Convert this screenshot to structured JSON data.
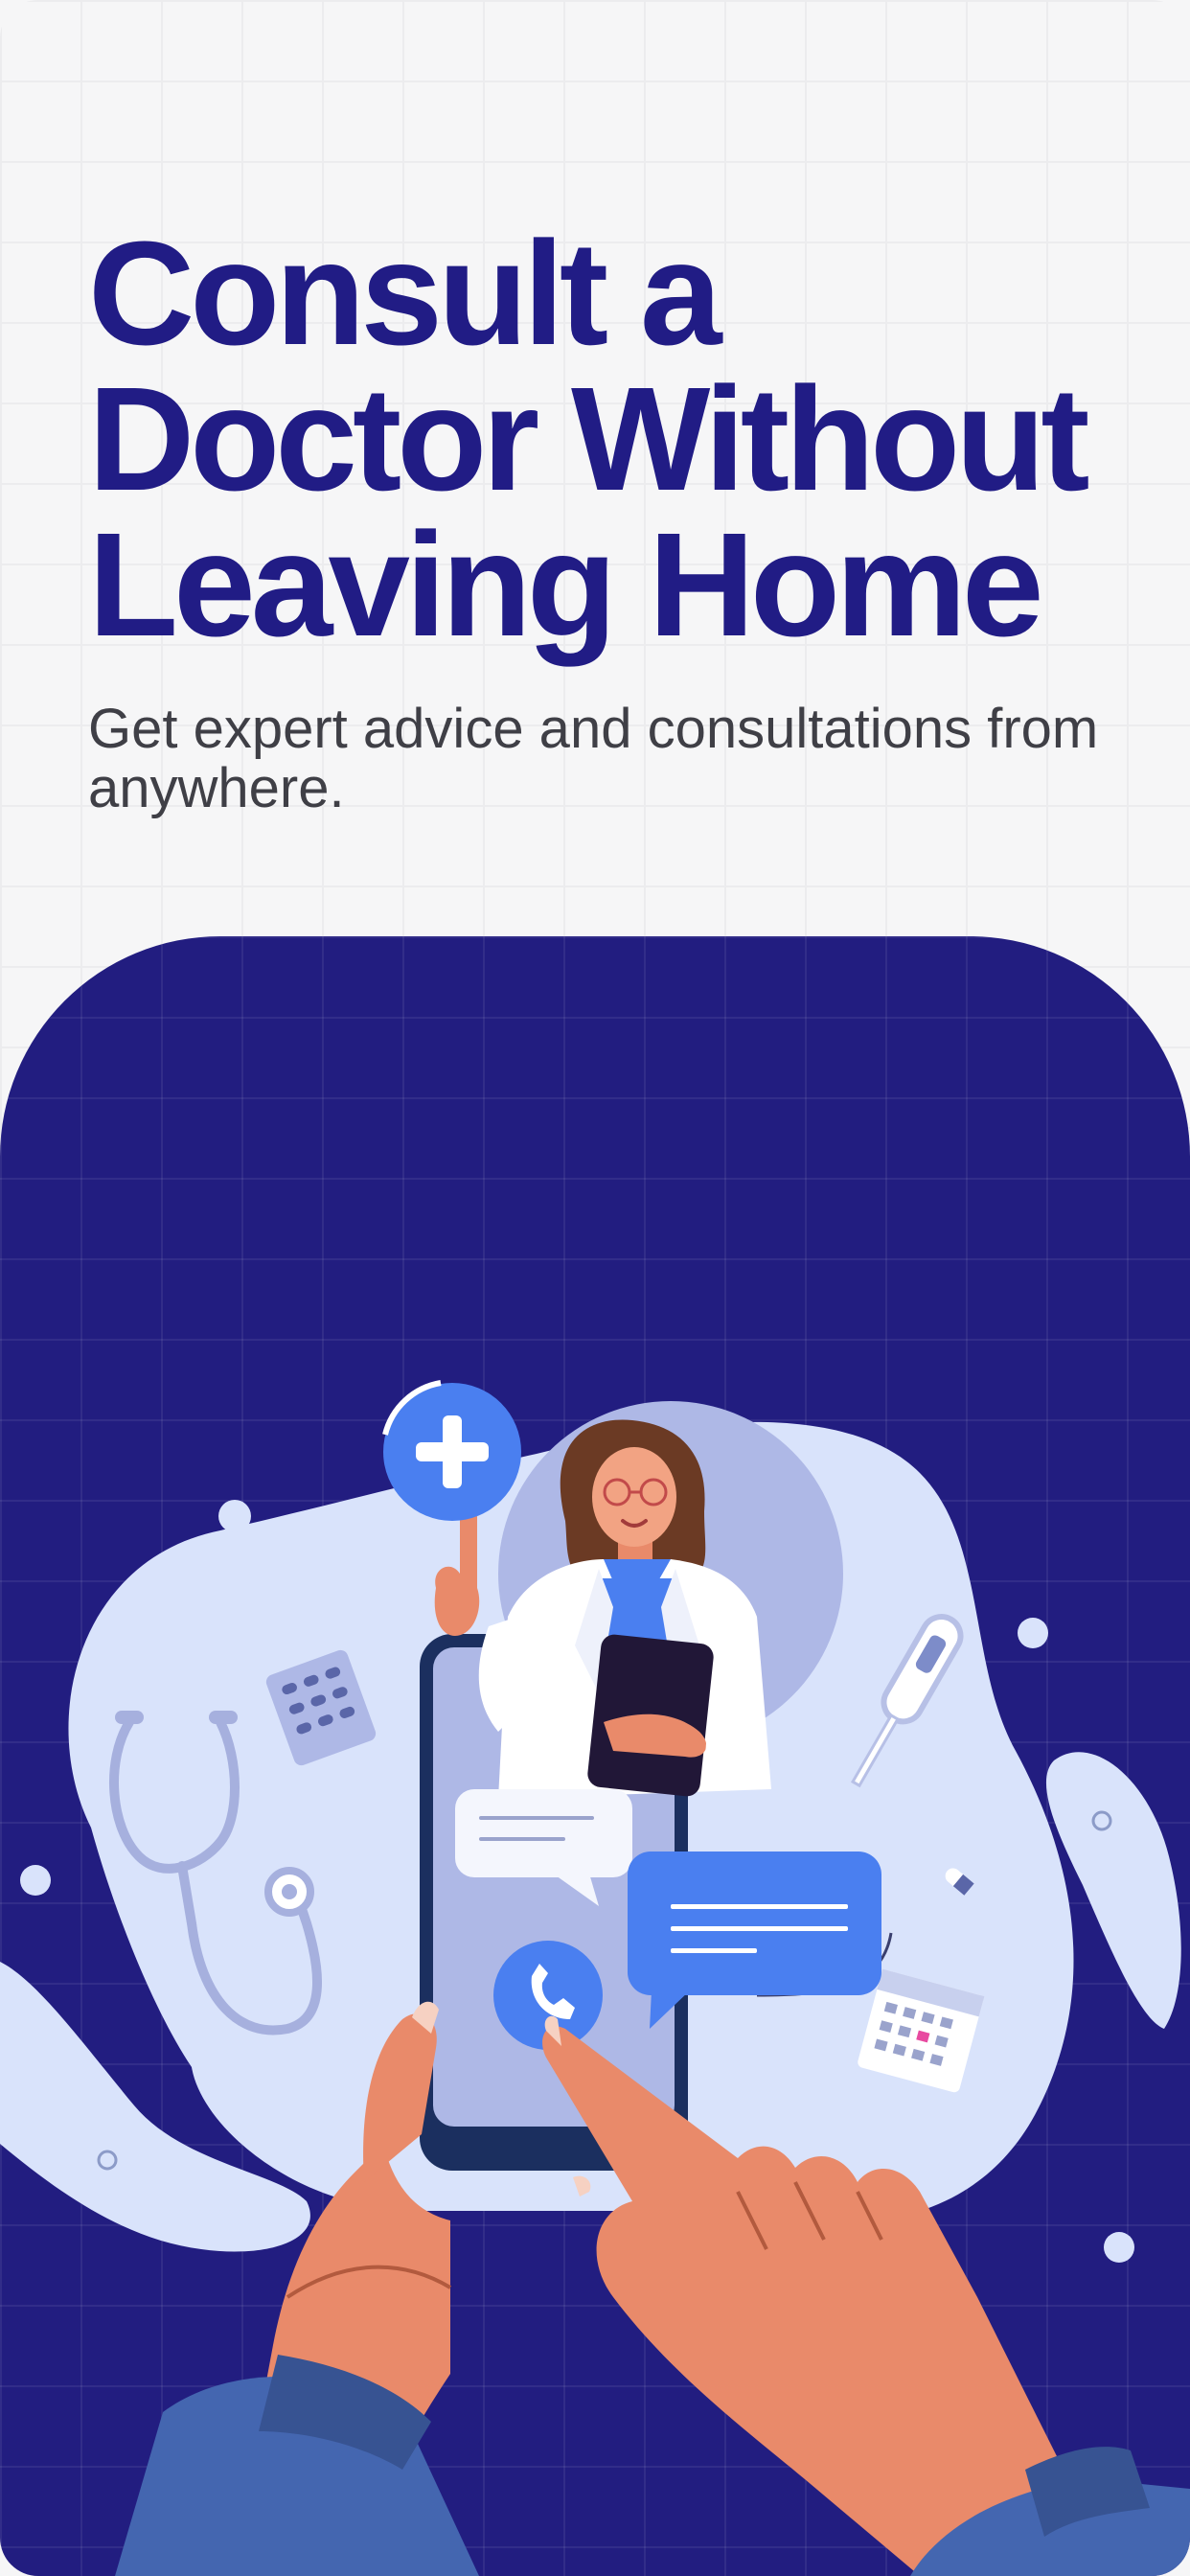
{
  "onboarding": {
    "headline_lines": [
      "Consult a",
      "Doctor Without",
      "Leaving Home"
    ],
    "subtitle": "Get expert advice and consultations from anywhere."
  },
  "illustration": {
    "icons": [
      "plus-icon",
      "stethoscope-icon",
      "thermometer-icon",
      "pill-pack-icon",
      "calendar-icon",
      "phone-call-icon",
      "chat-bubble-icon"
    ]
  },
  "colors": {
    "brand_navy": "#211c85",
    "panel_background": "#221d80",
    "accent_blue": "#4a7ff0",
    "blob": "#d9e3fb",
    "skin": "#e98a6a"
  }
}
